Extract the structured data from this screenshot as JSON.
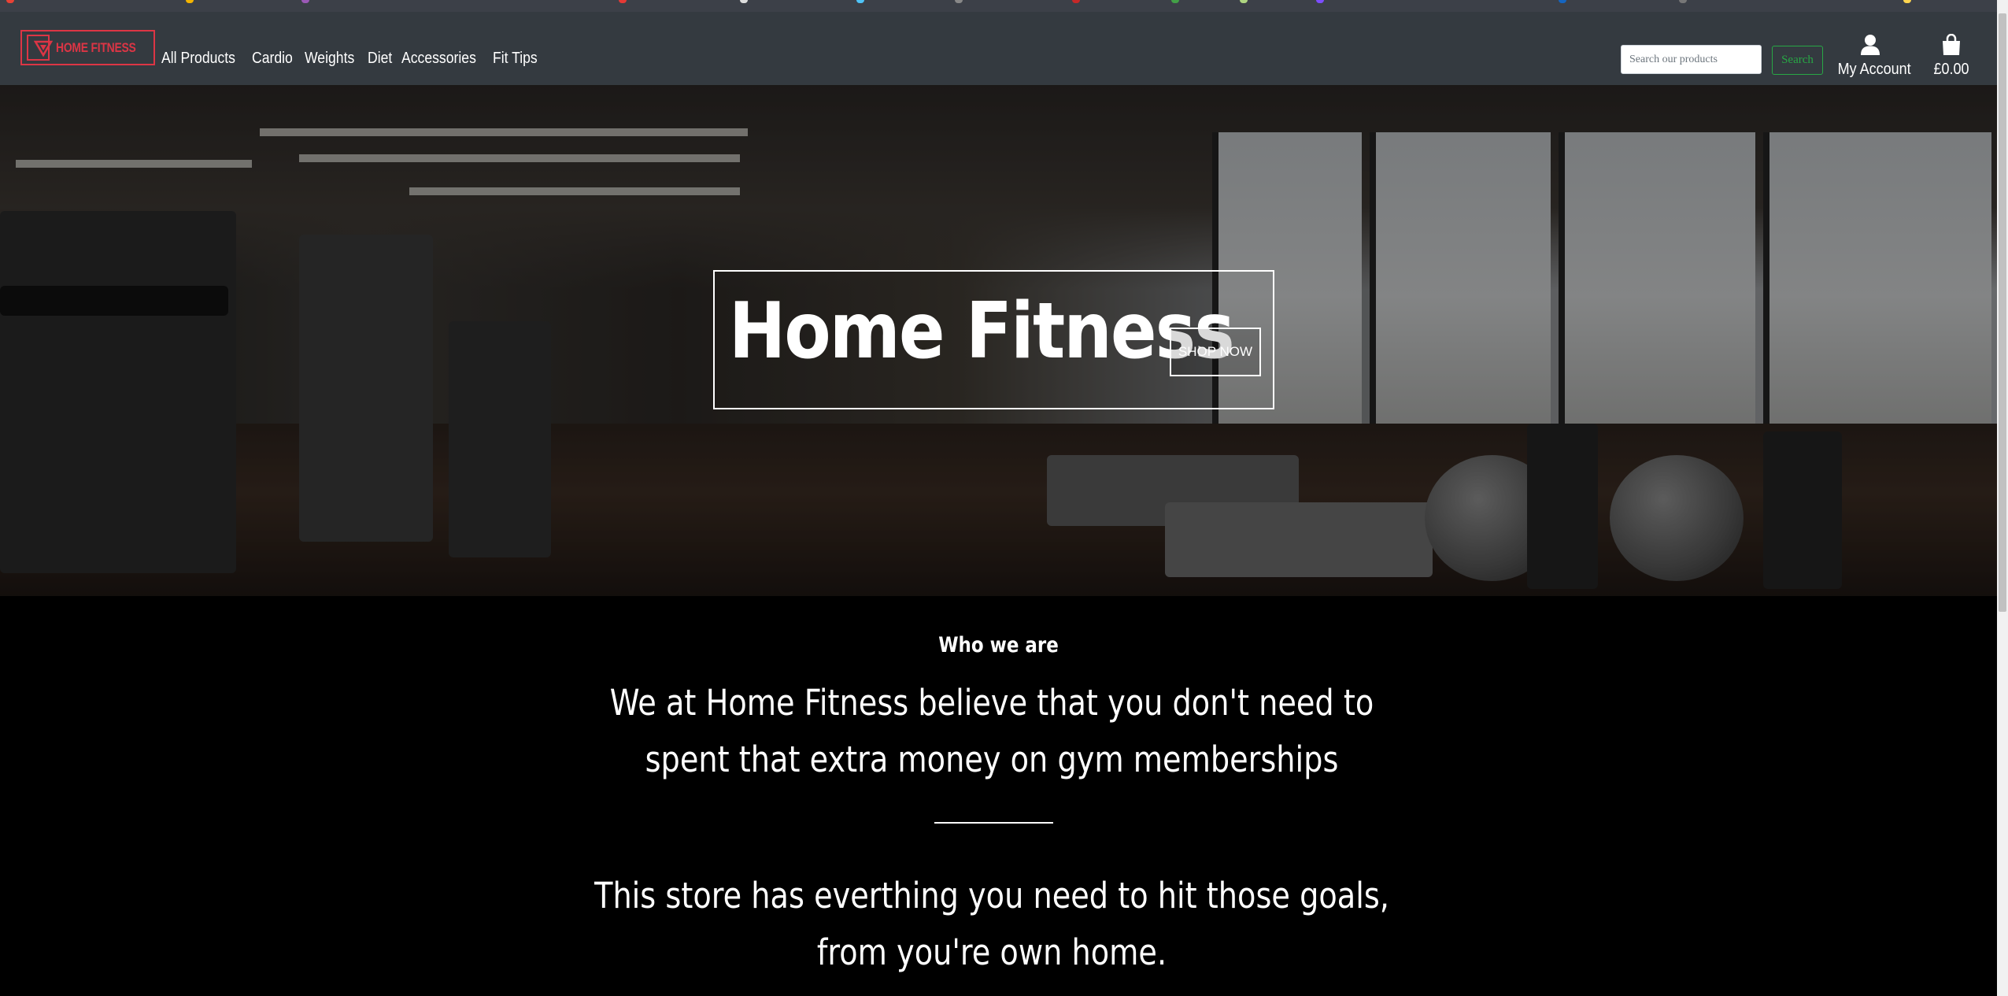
{
  "brand": {
    "name": "HOME FITNESS",
    "color": "#dc3545",
    "icon": "triangle-logo-icon"
  },
  "nav": {
    "items": [
      {
        "label": "All Products"
      },
      {
        "label": "Cardio"
      },
      {
        "label": "Weights"
      },
      {
        "label": "Diet"
      },
      {
        "label": "Accessories"
      },
      {
        "label": "Fit Tips"
      }
    ]
  },
  "search": {
    "placeholder": "Search our products",
    "value": "",
    "button_label": "Search",
    "button_color": "#28a745"
  },
  "account": {
    "label": "My Account",
    "icon": "user-icon"
  },
  "cart": {
    "total": "£0.00",
    "icon": "shopping-bag-icon"
  },
  "hero": {
    "title": "Home Fitness",
    "button_label": "SHOP NOW"
  },
  "about": {
    "heading": "Who we are",
    "statement": "We at Home Fitness believe that you don't need to spent that extra money on gym memberships",
    "statement2": "This store has everthing you need to hit those goals, from you're own home."
  },
  "colors": {
    "navbar_bg": "#343a40",
    "content_bg": "#000000"
  }
}
